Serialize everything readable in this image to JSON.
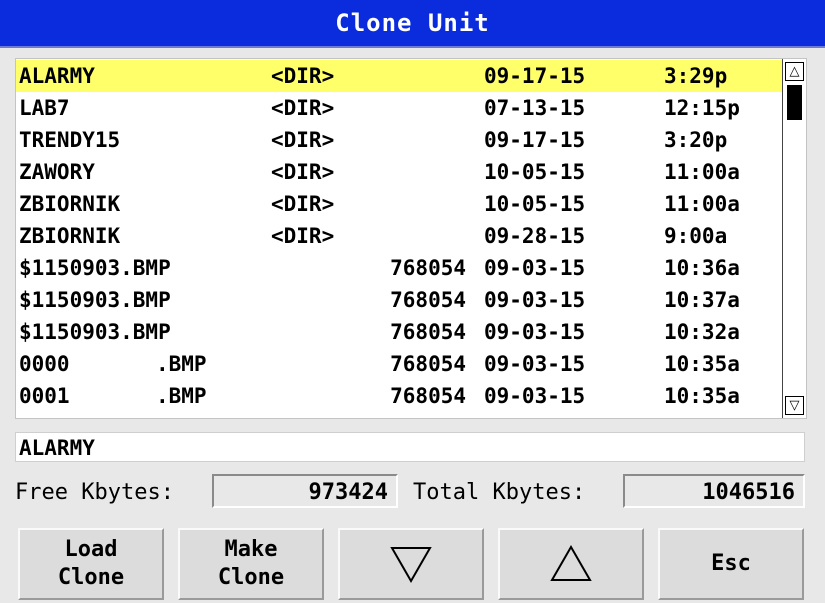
{
  "window": {
    "title": "Clone Unit"
  },
  "file_list": {
    "selected_index": 0,
    "rows": [
      {
        "name": "ALARMY",
        "ext": "",
        "dir": "<DIR>",
        "size": "",
        "date": "09-17-15",
        "time": "3:29p"
      },
      {
        "name": "LAB7",
        "ext": "",
        "dir": "<DIR>",
        "size": "",
        "date": "07-13-15",
        "time": "12:15p"
      },
      {
        "name": "TRENDY15",
        "ext": "",
        "dir": "<DIR>",
        "size": "",
        "date": "09-17-15",
        "time": "3:20p"
      },
      {
        "name": "ZAWORY",
        "ext": "",
        "dir": "<DIR>",
        "size": "",
        "date": "10-05-15",
        "time": "11:00a"
      },
      {
        "name": "ZBIORNIK",
        "ext": "",
        "dir": "<DIR>",
        "size": "",
        "date": "10-05-15",
        "time": "11:00a"
      },
      {
        "name": "ZBIORNIK",
        "ext": "",
        "dir": "<DIR>",
        "size": "",
        "date": "09-28-15",
        "time": "9:00a"
      },
      {
        "name": "$1150903.BMP",
        "ext": "",
        "dir": "",
        "size": "768054",
        "date": "09-03-15",
        "time": "10:36a"
      },
      {
        "name": "$1150903.BMP",
        "ext": "",
        "dir": "",
        "size": "768054",
        "date": "09-03-15",
        "time": "10:37a"
      },
      {
        "name": "$1150903.BMP",
        "ext": "",
        "dir": "",
        "size": "768054",
        "date": "09-03-15",
        "time": "10:32a"
      },
      {
        "name": "0000",
        "ext": ".BMP",
        "dir": "",
        "size": "768054",
        "date": "09-03-15",
        "time": "10:35a"
      },
      {
        "name": "0001",
        "ext": ".BMP",
        "dir": "",
        "size": "768054",
        "date": "09-03-15",
        "time": "10:35a"
      }
    ],
    "scrollbar": {
      "up_icon": "up-arrow-icon",
      "down_icon": "down-arrow-icon"
    }
  },
  "selection": {
    "value": "ALARMY"
  },
  "storage": {
    "free_label": "Free Kbytes:",
    "free_value": "973424",
    "total_label": "Total Kbytes:",
    "total_value": "1046516"
  },
  "buttons": {
    "load_line1": "Load",
    "load_line2": "Clone",
    "make_line1": "Make",
    "make_line2": "Clone",
    "down_icon": "triangle-down-icon",
    "up_icon": "triangle-up-icon",
    "esc": "Esc"
  },
  "colors": {
    "title_bar": "#0a2cdc",
    "selected_row": "#ffff6a"
  }
}
